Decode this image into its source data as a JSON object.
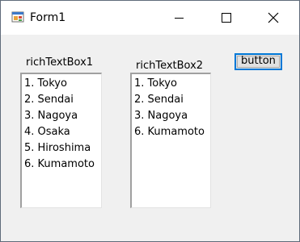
{
  "window": {
    "title": "Form1",
    "controls": [
      "minimize",
      "maximize",
      "close"
    ]
  },
  "labels": {
    "rich1": "richTextBox1",
    "rich2": "richTextBox2"
  },
  "richTextBox1": {
    "lines": [
      "1. Tokyo",
      "2. Sendai",
      "3. Nagoya",
      "4. Osaka",
      "5. Hiroshima",
      "6. Kumamoto"
    ]
  },
  "richTextBox2": {
    "lines": [
      "1. Tokyo",
      "2. Sendai",
      "3. Nagoya",
      "6. Kumamoto"
    ]
  },
  "button": {
    "label": "button",
    "focus_color": "#0078d7"
  },
  "icons": {
    "app": "windows-form-icon",
    "minimize": "minimize-icon",
    "maximize": "maximize-icon",
    "close": "close-icon"
  }
}
